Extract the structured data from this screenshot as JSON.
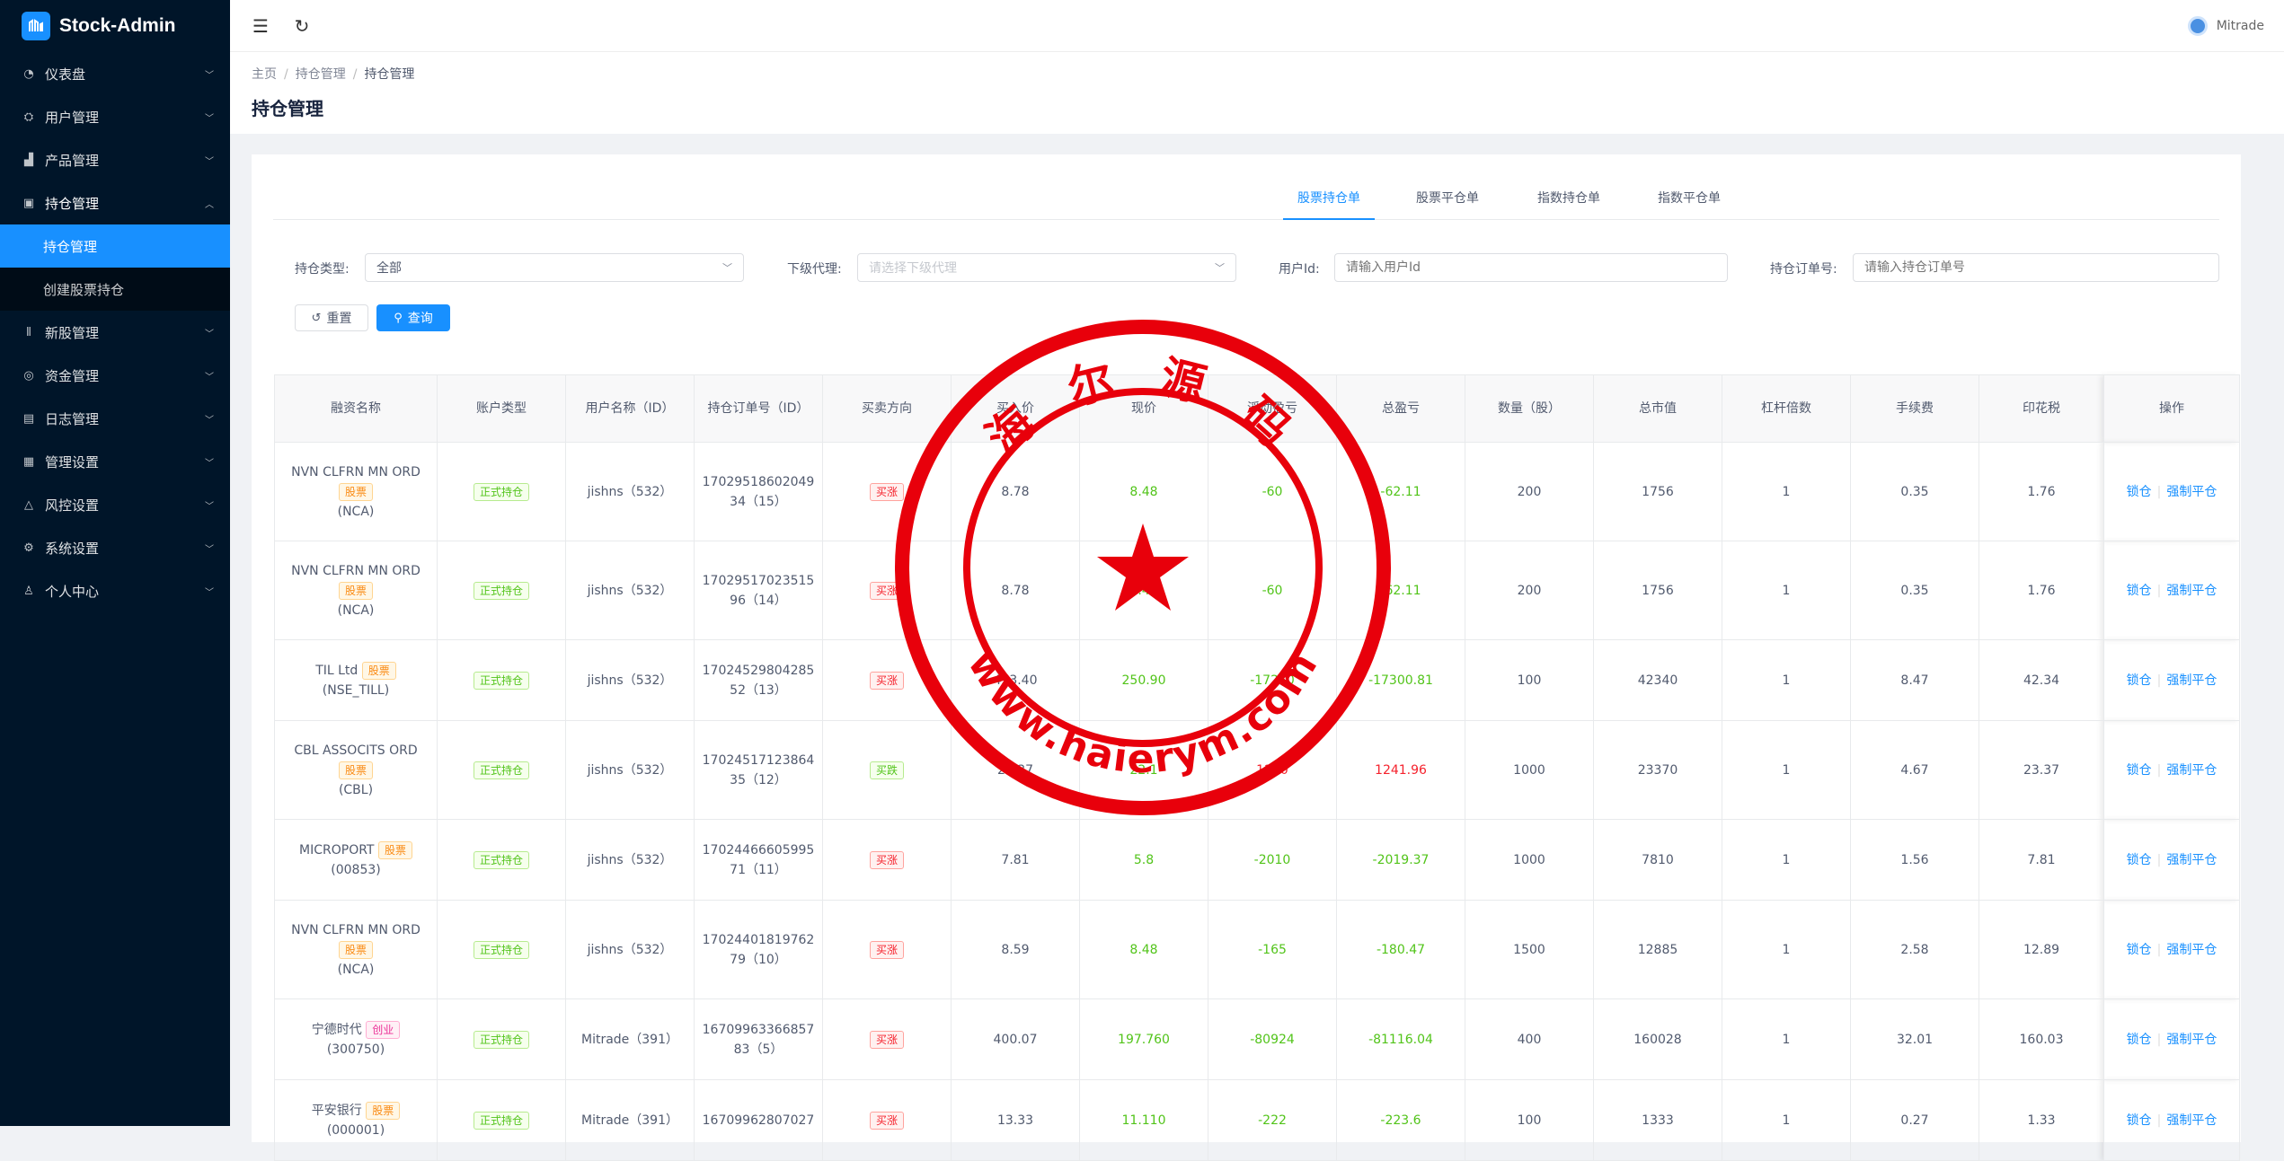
{
  "app": {
    "name": "Stock-Admin"
  },
  "sidebar": {
    "items": [
      {
        "label": "仪表盘",
        "icon": "dashboard-icon",
        "glyph": "◔"
      },
      {
        "label": "用户管理",
        "icon": "users-icon",
        "glyph": "⛭"
      },
      {
        "label": "产品管理",
        "icon": "chart-icon",
        "glyph": "▟"
      },
      {
        "label": "持仓管理",
        "icon": "position-icon",
        "glyph": "▣",
        "open": true,
        "children": [
          {
            "label": "持仓管理",
            "active": true
          },
          {
            "label": "创建股票持仓"
          }
        ]
      },
      {
        "label": "新股管理",
        "icon": "ipo-icon",
        "glyph": "⦀"
      },
      {
        "label": "资金管理",
        "icon": "money-icon",
        "glyph": "◎"
      },
      {
        "label": "日志管理",
        "icon": "log-icon",
        "glyph": "▤"
      },
      {
        "label": "管理设置",
        "icon": "settings-grid-icon",
        "glyph": "▦"
      },
      {
        "label": "风控设置",
        "icon": "warning-icon",
        "glyph": "△"
      },
      {
        "label": "系统设置",
        "icon": "gear-icon",
        "glyph": "⚙"
      },
      {
        "label": "个人中心",
        "icon": "user-icon",
        "glyph": "♙"
      }
    ]
  },
  "topbar": {
    "user_name": "Mitrade"
  },
  "header": {
    "breadcrumb": [
      "主页",
      "持仓管理",
      "持仓管理"
    ],
    "title": "持仓管理"
  },
  "tabs": [
    "股票持仓单",
    "股票平仓单",
    "指数持仓单",
    "指数平仓单"
  ],
  "filters": {
    "type_label": "持仓类型:",
    "type_value": "全部",
    "agent_label": "下级代理:",
    "agent_placeholder": "请选择下级代理",
    "userid_label": "用户Id:",
    "userid_placeholder": "请输入用户Id",
    "order_label": "持仓订单号:",
    "order_placeholder": "请输入持仓订单号",
    "reset": "重置",
    "search": "查询"
  },
  "table": {
    "headers": [
      "融资名称",
      "账户类型",
      "用户名称（ID）",
      "持仓订单号（ID）",
      "买卖方向",
      "买入价",
      "现价",
      "浮动盈亏",
      "总盈亏",
      "数量（股）",
      "总市值",
      "杠杆倍数",
      "手续费",
      "印花税",
      "操作"
    ],
    "actions": {
      "lock": "锁仓",
      "force": "强制平仓"
    },
    "rows": [
      {
        "name": "NVN CLFRN MN ORD",
        "tag": "股票",
        "tagtype": "stock",
        "code": "(NCA)",
        "acct": "正式持仓",
        "user": "jishns（532）",
        "order": "17029518602049",
        "order2": "34（15）",
        "dir": "买涨",
        "dirtype": "up",
        "buy": "8.78",
        "now": "8.48",
        "nowc": "neg",
        "float": "-60",
        "floatc": "neg",
        "total": "-62.11",
        "totalc": "neg",
        "qty": "200",
        "mv": "1756",
        "lev": "1",
        "fee": "0.35",
        "tax": "1.76"
      },
      {
        "name": "NVN CLFRN MN ORD",
        "tag": "股票",
        "tagtype": "stock",
        "code": "(NCA)",
        "acct": "正式持仓",
        "user": "jishns（532）",
        "order": "17029517023515",
        "order2": "96（14）",
        "dir": "买涨",
        "dirtype": "up",
        "buy": "8.78",
        "now": "8.48",
        "nowc": "neg",
        "float": "-60",
        "floatc": "neg",
        "total": "-62.11",
        "totalc": "neg",
        "qty": "200",
        "mv": "1756",
        "lev": "1",
        "fee": "0.35",
        "tax": "1.76"
      },
      {
        "name": "TIL Ltd",
        "tag": "股票",
        "tagtype": "stock",
        "code": "(NSE_TILL)",
        "acct": "正式持仓",
        "user": "jishns（532）",
        "order": "17024529804285",
        "order2": "52（13）",
        "dir": "买涨",
        "dirtype": "up",
        "buy": "423.40",
        "now": "250.90",
        "nowc": "neg",
        "float": "-17250",
        "floatc": "neg",
        "total": "-17300.81",
        "totalc": "neg",
        "qty": "100",
        "mv": "42340",
        "lev": "1",
        "fee": "8.47",
        "tax": "42.34"
      },
      {
        "name": "CBL ASSOCITS ORD",
        "tag": "股票",
        "tagtype": "stock",
        "code": "(CBL)",
        "acct": "正式持仓",
        "user": "jishns（532）",
        "order": "17024517123864",
        "order2": "35（12）",
        "dir": "买跌",
        "dirtype": "down",
        "buy": "23.37",
        "now": "22.1",
        "nowc": "neg",
        "float": "1270",
        "floatc": "pos",
        "total": "1241.96",
        "totalc": "pos",
        "qty": "1000",
        "mv": "23370",
        "lev": "1",
        "fee": "4.67",
        "tax": "23.37"
      },
      {
        "name": "MICROPORT",
        "tag": "股票",
        "tagtype": "stock",
        "code": "(00853)",
        "acct": "正式持仓",
        "user": "jishns（532）",
        "order": "17024466605995",
        "order2": "71（11）",
        "dir": "买涨",
        "dirtype": "up",
        "buy": "7.81",
        "now": "5.8",
        "nowc": "neg",
        "float": "-2010",
        "floatc": "neg",
        "total": "-2019.37",
        "totalc": "neg",
        "qty": "1000",
        "mv": "7810",
        "lev": "1",
        "fee": "1.56",
        "tax": "7.81"
      },
      {
        "name": "NVN CLFRN MN ORD",
        "tag": "股票",
        "tagtype": "stock",
        "code": "(NCA)",
        "acct": "正式持仓",
        "user": "jishns（532）",
        "order": "17024401819762",
        "order2": "79（10）",
        "dir": "买涨",
        "dirtype": "up",
        "buy": "8.59",
        "now": "8.48",
        "nowc": "neg",
        "float": "-165",
        "floatc": "neg",
        "total": "-180.47",
        "totalc": "neg",
        "qty": "1500",
        "mv": "12885",
        "lev": "1",
        "fee": "2.58",
        "tax": "12.89"
      },
      {
        "name": "宁德时代",
        "tag": "创业",
        "tagtype": "gem",
        "code": "(300750)",
        "acct": "正式持仓",
        "user": "Mitrade（391）",
        "order": "16709963366857",
        "order2": "83（5）",
        "dir": "买涨",
        "dirtype": "up",
        "buy": "400.07",
        "now": "197.760",
        "nowc": "neg",
        "float": "-80924",
        "floatc": "neg",
        "total": "-81116.04",
        "totalc": "neg",
        "qty": "400",
        "mv": "160028",
        "lev": "1",
        "fee": "32.01",
        "tax": "160.03"
      },
      {
        "name": "平安银行",
        "tag": "股票",
        "tagtype": "stock",
        "code": "(000001)",
        "acct": "正式持仓",
        "user": "Mitrade（391）",
        "order": "16709962807027",
        "order2": "",
        "dir": "买涨",
        "dirtype": "up",
        "buy": "13.33",
        "now": "11.110",
        "nowc": "neg",
        "float": "-222",
        "floatc": "neg",
        "total": "-223.6",
        "totalc": "neg",
        "qty": "100",
        "mv": "1333",
        "lev": "1",
        "fee": "0.27",
        "tax": "1.33"
      }
    ]
  },
  "watermark": {
    "top_text": "海 尔 源 码",
    "bottom_text": "www.haierym.com",
    "color": "#e8000b"
  }
}
